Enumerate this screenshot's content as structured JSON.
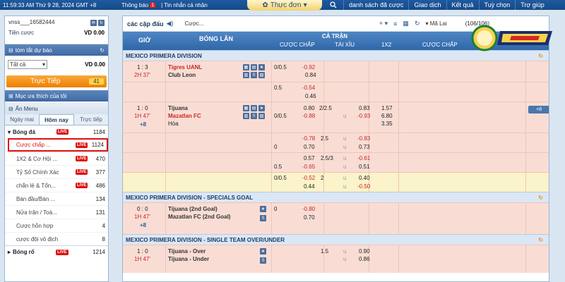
{
  "topbar": {
    "datetime": "11:59:33 AM Thứ 9 28, 2024 GMT +8",
    "notice_label": "Thông báo",
    "notice_badge": "1",
    "personal_msg": "Tin nhắn cá nhân",
    "menu_label": "Thực đơn",
    "nav": [
      "danh sách đã cược",
      "Giao dịch",
      "Kết quả",
      "Tuỳ chọn",
      "Trợ giúp"
    ]
  },
  "account": {
    "username": "vnss___16582444",
    "balance_label": "Tiền cược",
    "balance_value": "VD 0.00",
    "summary_title": "tóm tắt dự báo",
    "filter_value": "Tất cả",
    "filter_amount": "VD 0.00"
  },
  "live_button": {
    "label": "Trực Tiếp",
    "count": "41"
  },
  "favorites_title": "Mục ưa thích của tôi",
  "hide_menu": "Ẩn Menu",
  "day_tabs": [
    "Ngày mai",
    "Hôm nay",
    "Trực tiếp"
  ],
  "sports": {
    "football": {
      "label": "Bóng đá",
      "live": "LIVE",
      "count": "1184"
    },
    "basketball": {
      "label": "Bóng rổ",
      "live": "LIVE",
      "count": "1214"
    }
  },
  "bet_types": [
    {
      "label": "Cược chấp ...",
      "live": "LIVE",
      "count": "1124"
    },
    {
      "label": "1X2 & Cơ Hội ...",
      "live": "LIVE",
      "count": "470"
    },
    {
      "label": "Tỷ Số Chính Xác",
      "live": "LIVE",
      "count": "377"
    },
    {
      "label": "chẵn lẻ & Tổn...",
      "live": "LIVE",
      "count": "486"
    },
    {
      "label": "Bàn đầu/Bàn ...",
      "live": "",
      "count": "134"
    },
    {
      "label": "Nửa trận / Toà...",
      "live": "",
      "count": "131"
    },
    {
      "label": "Cược hỗn hợp",
      "live": "",
      "count": "4"
    },
    {
      "label": "cược đội vô địch",
      "live": "",
      "count": "8"
    }
  ],
  "main": {
    "title": "các cặp đấu",
    "subtitle": "Cược...",
    "odds_type": "Mã Lai",
    "page_info": "(106/106)",
    "columns": {
      "time": "GIỜ",
      "match": "BÓNG LĂN",
      "fulltime": "CẢ TRẬN",
      "handicap": "CƯỢC CHẤP",
      "overunder": "TÀI XỈU",
      "x12": "1X2",
      "handicap2": "CƯỢC CHẤP"
    },
    "leagues": [
      "MEXICO PRIMERA DIVISION",
      "MEXICO PRIMERA DIVISION - SPECIALS GOAL",
      "MEXICO PRIMERA DIVISION - SINGLE TEAM OVER/UNDER"
    ],
    "match1": {
      "score": "1 : 3",
      "time": "2H 37'",
      "home": "Tigres UANL",
      "away": "Club Leon",
      "hdp1": "0/0.5",
      "o1a": "-0.92",
      "o1b": "0.84",
      "hdp2": "0.5",
      "o2a": "-0.54",
      "o2b": "0.46"
    },
    "match2": {
      "score": "1 : 0",
      "time": "1H 47'",
      "extra": "+8",
      "home": "Tijuana",
      "away": "Mazatlan FC",
      "draw": "Hòa",
      "hdp": "0/0.5",
      "h_a": "0.80",
      "h_b": "-0.88",
      "ou": "2/2.5",
      "ou_u": "u",
      "ou_a": "0.83",
      "ou_b": "-0.93",
      "x1": "1.57",
      "x2": "6.80",
      "x3": "3.35",
      "more": "+8",
      "lines": [
        {
          "hdp": "",
          "a": "-0.78",
          "b": "0.70",
          "ou": "2.5",
          "oa": "-0.83",
          "ob": "0.73",
          "hdp2": "0"
        },
        {
          "hdp": "0.5",
          "a": "0.57",
          "b": "-0.65",
          "ou": "2.5/3",
          "oa": "-0.61",
          "ob": "0.51",
          "hdp2": ""
        },
        {
          "hdp": "0/0.5",
          "a": "-0.52",
          "b": "0.44",
          "ou": "2",
          "oa": "0.40",
          "ob": "-0.50",
          "hdp2": ""
        }
      ]
    },
    "match3": {
      "score": "0 : 0",
      "time": "1H 47'",
      "extra": "+8",
      "home": "Tijuana (2nd Goal)",
      "away": "Mazatlan FC (2nd Goal)",
      "hdp": "0",
      "a": "-0.80",
      "b": "0.70"
    },
    "match4": {
      "score": "1 : 0",
      "time": "1H 47'",
      "home": "Tijuana - Over",
      "away": "Tijuana - Under",
      "ou": "1.5",
      "a": "0.90",
      "b": "0.86"
    }
  }
}
